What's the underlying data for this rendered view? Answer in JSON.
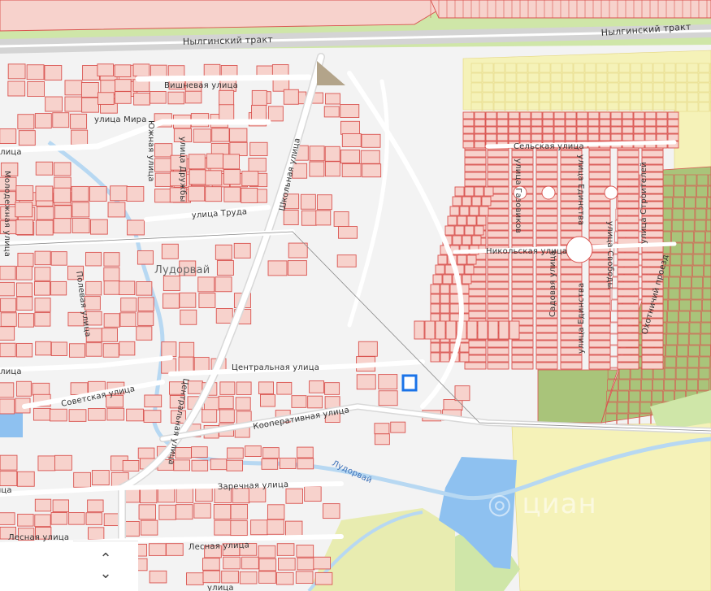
{
  "map": {
    "labels": {
      "nylga_tract_left": "Нылгинский тракт",
      "nylga_tract_right": "Нылгинский тракт",
      "vishnevaya": "Вишневая улица",
      "mira": "улица Мира",
      "yuzhnaya": "Южная улица",
      "druzhby": "улица Дружбы",
      "shkolnaya": "Школьная улица",
      "truda": "улица Труда",
      "molodezhnaya": "Молодежная улица",
      "polevaya": "Полевая улица",
      "ludorvai_town": "Лудорвай",
      "tsentralnaya": "Центральная улица",
      "sovetskaya": "Советская улица",
      "kooperativnaya": "Кооперативная улица",
      "tsentralnaya_v": "Центральная улица",
      "ludorvai_river": "Лудорвай",
      "zarechnaya": "Заречная улица",
      "lesnaya_1": "Лесная улица",
      "lesnaya_2": "Лесная улица",
      "selskaya": "Сельская улица",
      "nikolskaya": "Никольская улица",
      "gazovikov": "улица Газовиков",
      "edinstva_top": "улица Единства",
      "edinstva_bottom": "улица Единства",
      "stroiteley": "улица Строителей",
      "svobody": "улица Свободы",
      "sadovaya": "Садовая улица",
      "ohotnichiy": "Охотничий проезд",
      "edge_left_1": "улица",
      "edge_left_2": "улица",
      "edge_left_3": "улица",
      "edge_left_4": "улица"
    },
    "colors": {
      "background": "#f3f3f3",
      "plot_fill": "#f7d2cc",
      "plot_stroke": "#d9534f",
      "green_area": "#cfe6a8",
      "yellow_area": "#f5f2b8",
      "dark_green": "#a9c47a",
      "water": "#8ec1f0",
      "river": "#b7d8f2",
      "road": "#ffffff",
      "highway": "#cfcfcf",
      "selected_parcel": "#1a73e8"
    },
    "controls": {
      "zoom_icon": "⌃⌄"
    }
  }
}
